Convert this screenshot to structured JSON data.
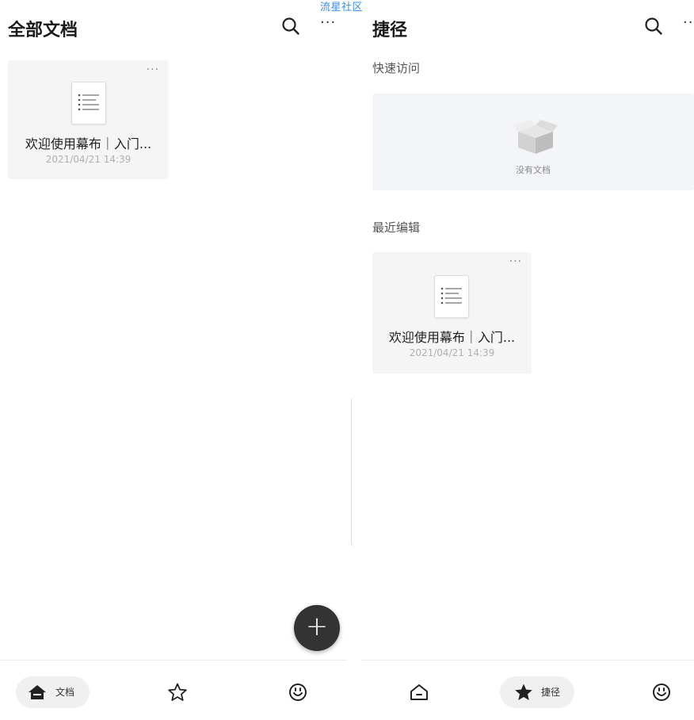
{
  "watermark": "流星社区",
  "left": {
    "title": "全部文档",
    "more_label": "···",
    "doc_card": {
      "more_label": "···",
      "title": "欢迎使用幕布｜入门...",
      "date": "2021/04/21 14:39"
    },
    "fab_label": "+",
    "tabbar": {
      "active_label": "文档"
    }
  },
  "right": {
    "title": "捷径",
    "more_label": "··",
    "quick_access_label": "快速访问",
    "empty_text": "没有文档",
    "recent_label": "最近编辑",
    "doc_card": {
      "more_label": "···",
      "title": "欢迎使用幕布｜入门...",
      "date": "2021/04/21 14:39"
    },
    "tabbar": {
      "active_label": "捷径"
    }
  }
}
